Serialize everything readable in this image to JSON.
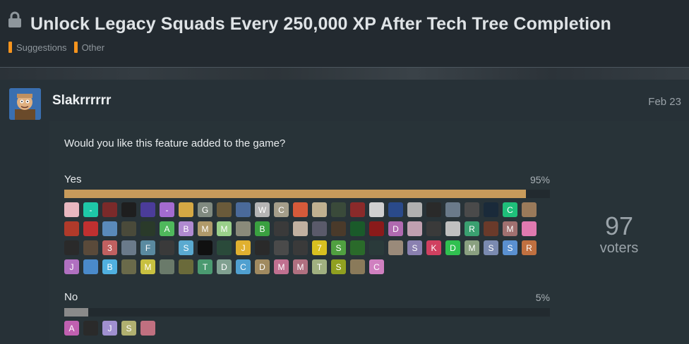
{
  "topic": {
    "title": "Unlock Legacy Squads Every 250,000 XP After Tech Tree Completion",
    "categories": [
      {
        "label": "Suggestions",
        "color": "#f7941d"
      },
      {
        "label": "Other",
        "color": "#f7941d"
      }
    ]
  },
  "post": {
    "username": "Slakrrrrrr",
    "date": "Feb 23"
  },
  "poll": {
    "question": "Would you like this feature added to the game?",
    "voters_count": "97",
    "voters_label": "voters",
    "options": [
      {
        "label": "Yes",
        "percent_text": "95%",
        "fraction": 0.95,
        "bar_color": "#c89b5b",
        "avatars": [
          {
            "letter": "",
            "color": "#e8b7c0"
          },
          {
            "letter": "-",
            "color": "#1ec8a8"
          },
          {
            "letter": "",
            "color": "#7a2a2a"
          },
          {
            "letter": "",
            "color": "#1e1e1e"
          },
          {
            "letter": "",
            "color": "#4b3c9a"
          },
          {
            "letter": "-",
            "color": "#a36bd0"
          },
          {
            "letter": "",
            "color": "#d4a844"
          },
          {
            "letter": "G",
            "color": "#808a80"
          },
          {
            "letter": "",
            "color": "#6a5a3a"
          },
          {
            "letter": "",
            "color": "#4a6a9a"
          },
          {
            "letter": "W",
            "color": "#b5b5b5"
          },
          {
            "letter": "C",
            "color": "#a59e8a"
          },
          {
            "letter": "",
            "color": "#d65a3a"
          },
          {
            "letter": "",
            "color": "#c0b090"
          },
          {
            "letter": "",
            "color": "#3a4a3a"
          },
          {
            "letter": "",
            "color": "#8a2a2a"
          },
          {
            "letter": "",
            "color": "#d0d0d0"
          },
          {
            "letter": "",
            "color": "#2a4a8a"
          },
          {
            "letter": "",
            "color": "#b0b0b0"
          },
          {
            "letter": "",
            "color": "#2a2a2a"
          },
          {
            "letter": "",
            "color": "#6a7a8a"
          },
          {
            "letter": "",
            "color": "#4a4a4a"
          },
          {
            "letter": "",
            "color": "#1a2a3a"
          },
          {
            "letter": "C",
            "color": "#1fbf7a"
          },
          {
            "letter": "",
            "color": "#9a7a5a"
          },
          {
            "letter": "",
            "color": "#b03a2a"
          },
          {
            "letter": "",
            "color": "#c03030"
          },
          {
            "letter": "",
            "color": "#5a8aba"
          },
          {
            "letter": "",
            "color": "#4a4a3a"
          },
          {
            "letter": "",
            "color": "#2a3a2a"
          },
          {
            "letter": "A",
            "color": "#4fb85c"
          },
          {
            "letter": "B",
            "color": "#b08ad0"
          },
          {
            "letter": "M",
            "color": "#b09a6a"
          },
          {
            "letter": "M",
            "color": "#9ad08a"
          },
          {
            "letter": "",
            "color": "#8a8a7a"
          },
          {
            "letter": "B",
            "color": "#3aa040"
          },
          {
            "letter": "",
            "color": "#3a3a3a"
          },
          {
            "letter": "",
            "color": "#c0b0a0"
          },
          {
            "letter": "",
            "color": "#5a5a6a"
          },
          {
            "letter": "",
            "color": "#4a3a2a"
          },
          {
            "letter": "",
            "color": "#1a5a2a"
          },
          {
            "letter": "",
            "color": "#8a1a1a"
          },
          {
            "letter": "D",
            "color": "#b06ab0"
          },
          {
            "letter": "",
            "color": "#c0a0b0"
          },
          {
            "letter": "",
            "color": "#3a3a3a"
          },
          {
            "letter": "",
            "color": "#c0c0c0"
          },
          {
            "letter": "R",
            "color": "#3aa070"
          },
          {
            "letter": "",
            "color": "#6a3a2a"
          },
          {
            "letter": "M",
            "color": "#a07070"
          },
          {
            "letter": "",
            "color": "#e07ab0"
          },
          {
            "letter": "",
            "color": "#2a2a2a"
          },
          {
            "letter": "",
            "color": "#5a4a3a"
          },
          {
            "letter": "3",
            "color": "#c06060"
          },
          {
            "letter": "",
            "color": "#6a7a8a"
          },
          {
            "letter": "F",
            "color": "#5a8aa0"
          },
          {
            "letter": "",
            "color": "#3a3a3a"
          },
          {
            "letter": "S",
            "color": "#5aaad0"
          },
          {
            "letter": "",
            "color": "#101010"
          },
          {
            "letter": "",
            "color": "#2a4a3a"
          },
          {
            "letter": "J",
            "color": "#e0b030"
          },
          {
            "letter": "",
            "color": "#2a2a2a"
          },
          {
            "letter": "",
            "color": "#4a4a4a"
          },
          {
            "letter": "",
            "color": "#3a3a3a"
          },
          {
            "letter": "7",
            "color": "#d8c020"
          },
          {
            "letter": "S",
            "color": "#50a040"
          },
          {
            "letter": "",
            "color": "#2a6a2a"
          },
          {
            "letter": "",
            "color": "#2a3a3a"
          },
          {
            "letter": "",
            "color": "#9a8a7a"
          },
          {
            "letter": "S",
            "color": "#8a80b0"
          },
          {
            "letter": "K",
            "color": "#d04060"
          },
          {
            "letter": "D",
            "color": "#30c050"
          },
          {
            "letter": "M",
            "color": "#8aa080"
          },
          {
            "letter": "S",
            "color": "#7a8ab0"
          },
          {
            "letter": "S",
            "color": "#5a90d0"
          },
          {
            "letter": "R",
            "color": "#c07040"
          },
          {
            "letter": "J",
            "color": "#b070c0"
          },
          {
            "letter": "",
            "color": "#4a8aca"
          },
          {
            "letter": "B",
            "color": "#50b0e0"
          },
          {
            "letter": "",
            "color": "#6a6a4a"
          },
          {
            "letter": "M",
            "color": "#c8c040"
          },
          {
            "letter": "",
            "color": "#6a7a6a"
          },
          {
            "letter": "",
            "color": "#6a6a3a"
          },
          {
            "letter": "T",
            "color": "#4a9a70"
          },
          {
            "letter": "D",
            "color": "#80a090"
          },
          {
            "letter": "C",
            "color": "#50a0d0"
          },
          {
            "letter": "D",
            "color": "#a08a60"
          },
          {
            "letter": "M",
            "color": "#c07090"
          },
          {
            "letter": "M",
            "color": "#b07080"
          },
          {
            "letter": "T",
            "color": "#a0b080"
          },
          {
            "letter": "S",
            "color": "#90a020"
          },
          {
            "letter": "",
            "color": "#8a7a5a"
          },
          {
            "letter": "C",
            "color": "#d080c0"
          }
        ]
      },
      {
        "label": "No",
        "percent_text": "5%",
        "fraction": 0.05,
        "bar_color": "#8a8a8a",
        "avatars": [
          {
            "letter": "A",
            "color": "#c060b0"
          },
          {
            "letter": "",
            "color": "#2a2a2a"
          },
          {
            "letter": "J",
            "color": "#a090d0"
          },
          {
            "letter": "S",
            "color": "#b0b070"
          },
          {
            "letter": "",
            "color": "#c07080"
          }
        ]
      }
    ]
  }
}
